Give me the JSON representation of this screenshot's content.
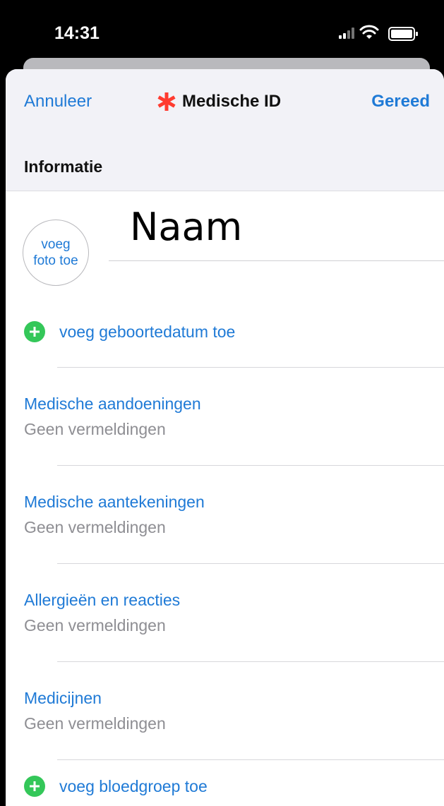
{
  "status_bar": {
    "time": "14:31",
    "icons": [
      "signal-icon",
      "wifi-icon",
      "battery-icon"
    ]
  },
  "navigation": {
    "cancel_label": "Annuleer",
    "title": "Medische ID",
    "done_label": "Gereed",
    "title_icon": "asterisk-icon"
  },
  "section": {
    "label": "Informatie"
  },
  "profile": {
    "photo_line1": "voeg",
    "photo_line2": "foto toe",
    "name_placeholder": "Naam"
  },
  "actions": {
    "add_birthdate": "voeg geboortedatum toe",
    "add_bloodtype": "voeg bloedgroep toe"
  },
  "fields": [
    {
      "title": "Medische aandoeningen",
      "value": "Geen vermeldingen"
    },
    {
      "title": "Medische aantekeningen",
      "value": "Geen vermeldingen"
    },
    {
      "title": "Allergieën en reacties",
      "value": "Geen vermeldingen"
    },
    {
      "title": "Medicijnen",
      "value": "Geen vermeldingen"
    }
  ],
  "colors": {
    "accent": "#1f7ad6",
    "secondary_text": "#8e8e93",
    "danger": "#ff3b30",
    "success": "#34c759"
  }
}
